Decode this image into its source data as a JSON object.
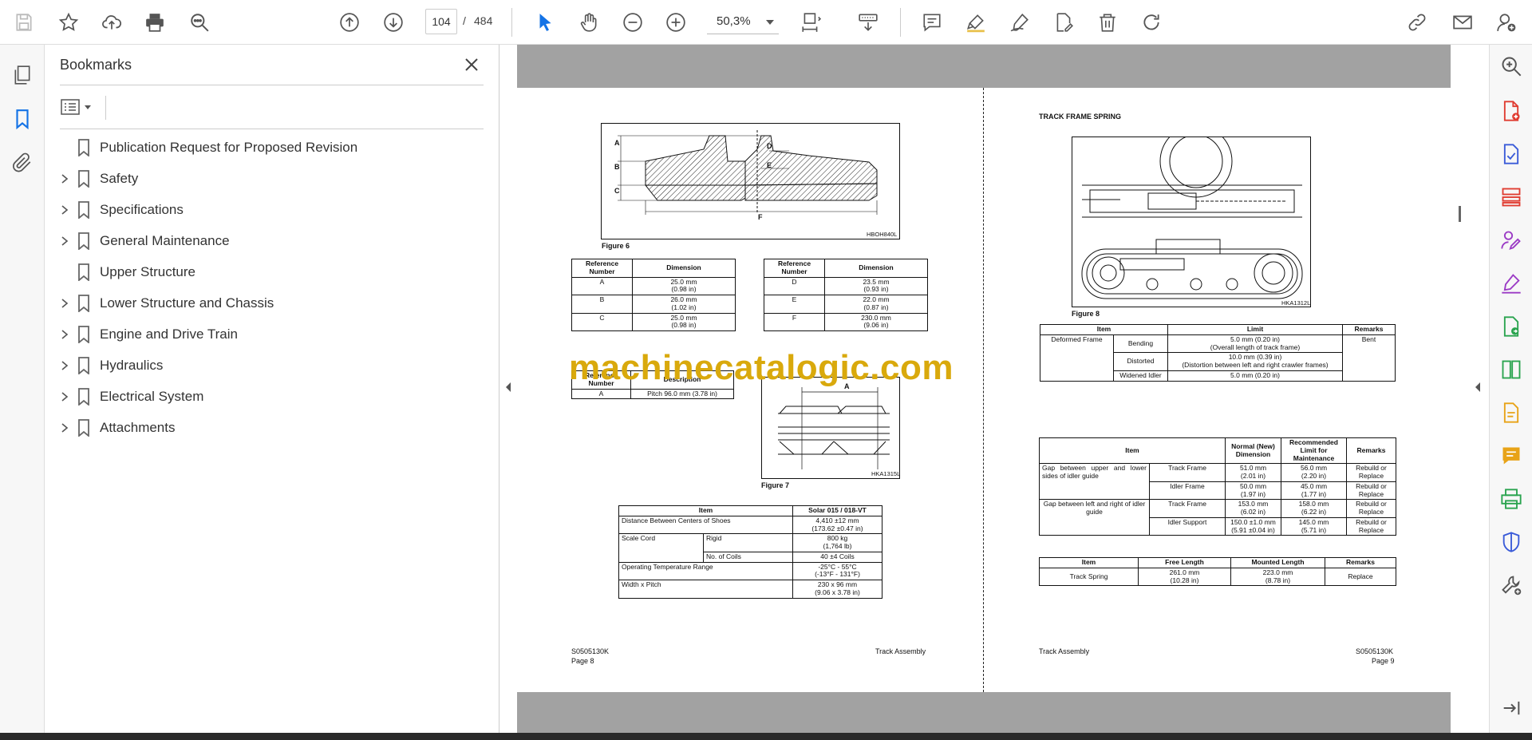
{
  "toolbar": {
    "page_current": "104",
    "page_separator": "/",
    "page_total": "484",
    "zoom": "50,3%"
  },
  "bookmarks": {
    "title": "Bookmarks",
    "items": [
      {
        "label": "Publication Request for Proposed Revision",
        "expandable": false
      },
      {
        "label": "Safety",
        "expandable": true
      },
      {
        "label": "Specifications",
        "expandable": true
      },
      {
        "label": "General Maintenance",
        "expandable": true
      },
      {
        "label": "Upper Structure",
        "expandable": false
      },
      {
        "label": "Lower Structure and Chassis",
        "expandable": true
      },
      {
        "label": "Engine and Drive Train",
        "expandable": true
      },
      {
        "label": "Hydraulics",
        "expandable": true
      },
      {
        "label": "Electrical System",
        "expandable": true
      },
      {
        "label": "Attachments",
        "expandable": true
      }
    ]
  },
  "watermark": "machinecatalogic.com",
  "left_page": {
    "fig6_caption": "Figure 6",
    "fig6_code": "HBOH840L",
    "fig6_labels": [
      "A",
      "B",
      "C",
      "D",
      "E",
      "F"
    ],
    "table1": {
      "headers": [
        "Reference Number",
        "Dimension"
      ],
      "rows": [
        [
          "A",
          "25.0 mm",
          "(0.98 in)"
        ],
        [
          "B",
          "26.0 mm",
          "(1.02 in)"
        ],
        [
          "C",
          "25.0 mm",
          "(0.98 in)"
        ]
      ]
    },
    "table2": {
      "headers": [
        "Reference Number",
        "Dimension"
      ],
      "rows": [
        [
          "D",
          "23.5 mm",
          "(0.93 in)"
        ],
        [
          "E",
          "22.0 mm",
          "(0.87 in)"
        ],
        [
          "F",
          "230.0 mm",
          "(9.06 in)"
        ]
      ]
    },
    "table3": {
      "headers": [
        "Reference Number",
        "Description"
      ],
      "rows": [
        [
          "A",
          "Pitch 96.0 mm (3.78 in)"
        ]
      ]
    },
    "fig7_caption": "Figure 7",
    "fig7_code": "HKA1315L",
    "fig7_label": "A",
    "table4": {
      "headers": [
        "Item",
        "Solar 015 / 018-VT"
      ],
      "rows": [
        {
          "item": "Distance Between Centers of Shoes",
          "sub": "",
          "v1": "4,410 ±12 mm",
          "v2": "(173.62 ±0.47 in)"
        },
        {
          "item": "Scale Cord",
          "sub": "Rigid",
          "v1": "800 kg",
          "v2": "(1,764 lb)"
        },
        {
          "item": "",
          "sub": "No. of Coils",
          "v1": "40 ±4 Coils",
          "v2": ""
        },
        {
          "item": "Operating Temperature Range",
          "sub": "",
          "v1": "-25°C - 55°C",
          "v2": "(-13°F - 131°F)"
        },
        {
          "item": "Width x Pitch",
          "sub": "",
          "v1": "230 x 96 mm",
          "v2": "(9.06 x 3.78 in)"
        }
      ]
    },
    "footer_code": "S0505130K",
    "footer_page": "Page 8",
    "footer_section": "Track Assembly"
  },
  "right_page": {
    "heading": "TRACK FRAME SPRING",
    "fig8_caption": "Figure 8",
    "fig8_code": "HKA1312L",
    "table5": {
      "headers": [
        "Item",
        "Limit",
        "Remarks"
      ],
      "group": "Deformed Frame",
      "remark": "Bent",
      "rows": [
        {
          "sub": "Bending",
          "l1": "5.0 mm (0.20 in)",
          "l2": "(Overall length of track frame)"
        },
        {
          "sub": "Distorted",
          "l1": "10.0 mm (0.39 in)",
          "l2": "(Distortion between left and right crawler frames)"
        },
        {
          "sub": "Widened Idler",
          "l1": "5.0 mm (0.20 in)",
          "l2": ""
        }
      ]
    },
    "table6": {
      "headers": [
        "Item",
        "Normal (New) Dimension",
        "Recommended Limit for Maintenance",
        "Remarks"
      ],
      "groups": [
        {
          "label": "Gap between upper and lower sides of idler guide",
          "rows": [
            {
              "sub": "Track Frame",
              "n1": "51.0 mm",
              "n2": "(2.01 in)",
              "r1": "56.0 mm",
              "r2": "(2.20 in)",
              "m1": "Rebuild or",
              "m2": "Replace"
            },
            {
              "sub": "Idler Frame",
              "n1": "50.0 mm",
              "n2": "(1.97 in)",
              "r1": "45.0 mm",
              "r2": "(1.77 in)",
              "m1": "Rebuild or",
              "m2": "Replace"
            }
          ]
        },
        {
          "label": "Gap between left and right of idler guide",
          "rows": [
            {
              "sub": "Track Frame",
              "n1": "153.0 mm",
              "n2": "(6.02 in)",
              "r1": "158.0 mm",
              "r2": "(6.22 in)",
              "m1": "Rebuild or",
              "m2": "Replace"
            },
            {
              "sub": "Idler Support",
              "n1": "150.0 ±1.0 mm",
              "n2": "(5.91 ±0.04 in)",
              "r1": "145.0 mm",
              "r2": "(5.71 in)",
              "m1": "Rebuild or",
              "m2": "Replace"
            }
          ]
        }
      ]
    },
    "table7": {
      "headers": [
        "Item",
        "Free Length",
        "Mounted Length",
        "Remarks"
      ],
      "row": {
        "item": "Track Spring",
        "f1": "261.0 mm",
        "f2": "(10.28 in)",
        "m1": "223.0 mm",
        "m2": "(8.78 in)",
        "remark": "Replace"
      }
    },
    "footer_section": "Track Assembly",
    "footer_code": "S0505130K",
    "footer_page": "Page 9"
  }
}
